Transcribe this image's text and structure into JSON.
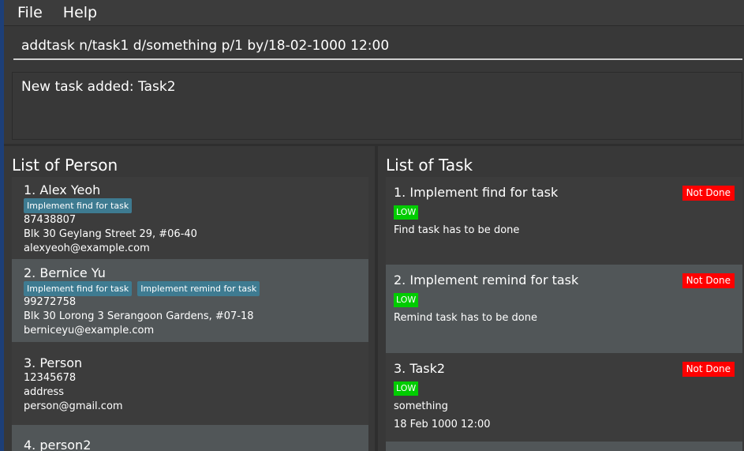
{
  "menu": {
    "file": "File",
    "help": "Help"
  },
  "command": {
    "value": "addtask n/task1 d/something p/1 by/18-02-1000 12:00"
  },
  "result": {
    "text": "New task added: Task2"
  },
  "persons": {
    "title": "List of Person",
    "items": [
      {
        "name": "1.  Alex Yeoh",
        "tags": [
          "Implement find for task"
        ],
        "phone": "87438807",
        "address": "Blk 30 Geylang Street 29, #06-40",
        "email": "alexyeoh@example.com"
      },
      {
        "name": "2.  Bernice Yu",
        "tags": [
          "Implement find for task",
          "Implement remind for task"
        ],
        "phone": "99272758",
        "address": "Blk 30 Lorong 3 Serangoon Gardens, #07-18",
        "email": "berniceyu@example.com"
      },
      {
        "name": "3.  Person",
        "tags": [],
        "phone": "12345678",
        "address": "address",
        "email": "person@gmail.com"
      },
      {
        "name": "4.  person2"
      }
    ]
  },
  "tasks": {
    "title": "List of Task",
    "items": [
      {
        "title": "1. Implement find for task",
        "status": "Not Done",
        "priority": "LOW",
        "description": "Find task has to be done"
      },
      {
        "title": "2. Implement remind for task",
        "status": "Not Done",
        "priority": "LOW",
        "description": "Remind task has to be done"
      },
      {
        "title": "3. Task2",
        "status": "Not Done",
        "priority": "LOW",
        "description": "something",
        "deadline": "18 Feb 1000 12:00"
      }
    ]
  },
  "colors": {
    "status_not_done": "#ff0000",
    "priority_low": "#00cc00",
    "tag": "#3e7b91",
    "accent_edge": "#1d3f78"
  }
}
